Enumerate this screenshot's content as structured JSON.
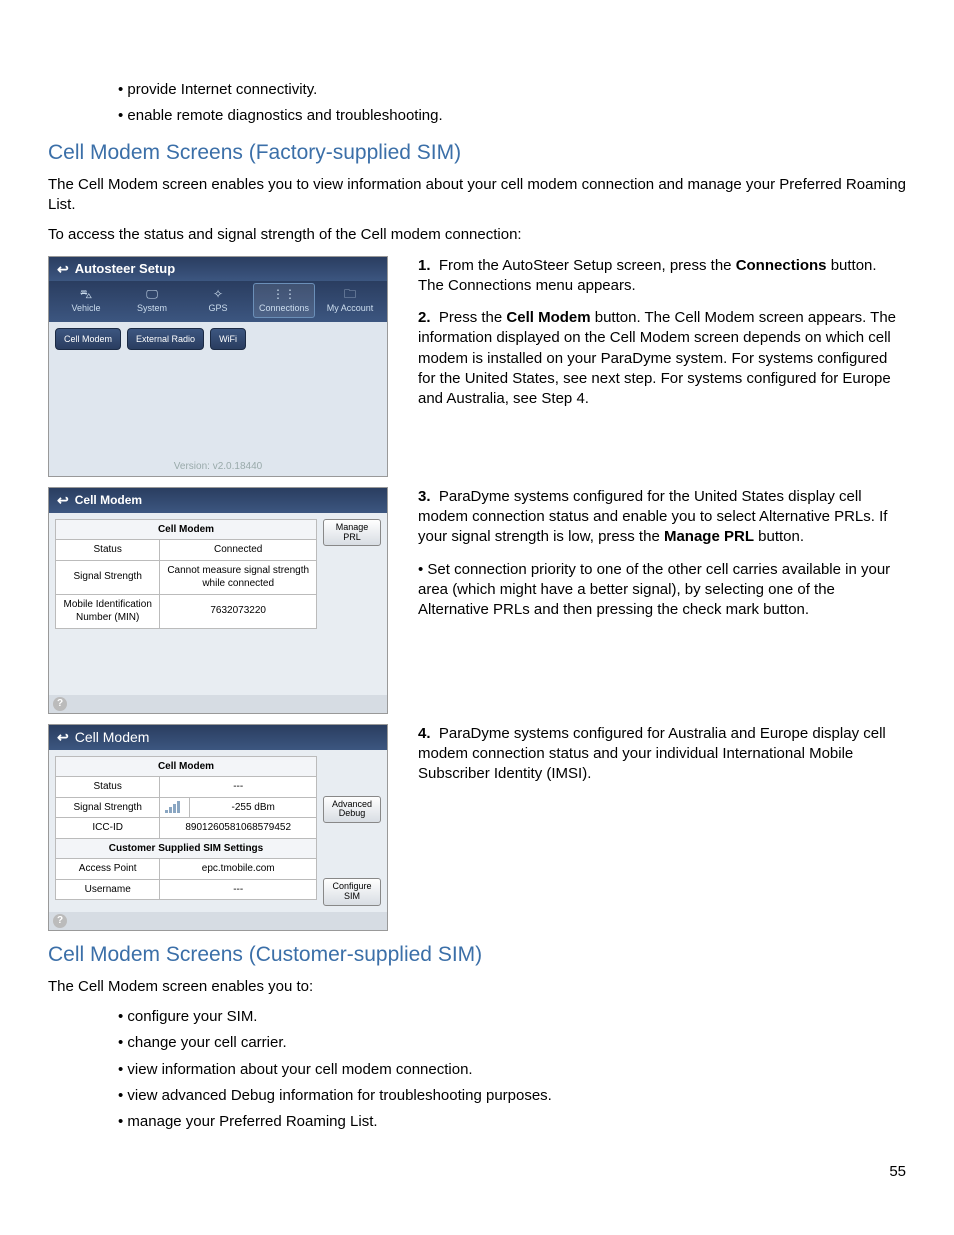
{
  "intro_bullets": [
    "provide Internet connectivity.",
    "enable remote diagnostics and troubleshooting."
  ],
  "section1": {
    "heading": "Cell Modem Screens (Factory-supplied SIM)",
    "para1": "The Cell Modem screen enables you to view information about your cell modem connection and manage your Preferred Roaming List.",
    "para2": "To access the status and signal strength of the Cell modem connection:"
  },
  "steps": {
    "s1_pre": "From the AutoSteer Setup screen, press the ",
    "s1_bold": "Connections",
    "s1_post": " button. The Connections menu appears.",
    "s2_pre": "Press the ",
    "s2_bold": "Cell Modem",
    "s2_post": " button. The Cell Modem screen appears. The information displayed on the Cell Modem screen depends on which cell modem is installed on your ParaDyme system. For systems configured for the United States, see next step. For systems configured for Europe and Australia, see Step 4.",
    "s3_pre": "ParaDyme systems configured for the United States display cell modem connection status and enable you to select Alternative PRLs. If your signal strength is low, press the ",
    "s3_bold": "Manage PRL",
    "s3_post": " button.",
    "s3_sub": "• Set connection priority to one of the other cell carries available in your area (which might have a better signal), by selecting one of the Alternative PRLs and then pressing the check mark button.",
    "s4": "ParaDyme systems configured for Australia and Europe display cell modem connection status and your individual International Mobile Subscriber Identity (IMSI)."
  },
  "shot1": {
    "title": "Autosteer Setup",
    "nav": [
      "Vehicle",
      "System",
      "GPS",
      "Connections",
      "My Account"
    ],
    "pills": [
      "Cell Modem",
      "External Radio",
      "WiFi"
    ],
    "version": "Version: v2.0.18440"
  },
  "shot2": {
    "title": "Cell Modem",
    "table_header": "Cell Modem",
    "rows": [
      {
        "label": "Status",
        "value": "Connected"
      },
      {
        "label": "Signal Strength",
        "value": "Cannot measure signal strength while connected"
      },
      {
        "label": "Mobile Identification Number (MIN)",
        "value": "7632073220"
      }
    ],
    "side_button": "Manage\nPRL"
  },
  "shot3": {
    "title": "Cell Modem",
    "table1_header": "Cell Modem",
    "rows1": [
      {
        "label": "Status",
        "value": "---"
      },
      {
        "label": "Signal Strength",
        "value": "-255 dBm"
      },
      {
        "label": "ICC-ID",
        "value": "8901260581068579452"
      }
    ],
    "table2_header": "Customer Supplied SIM Settings",
    "rows2": [
      {
        "label": "Access Point",
        "value": "epc.tmobile.com"
      },
      {
        "label": "Username",
        "value": "---"
      }
    ],
    "side_btn1": "Advanced\nDebug",
    "side_btn2": "Configure\nSIM"
  },
  "section2": {
    "heading": "Cell Modem Screens (Customer-supplied SIM)",
    "para": "The Cell Modem screen enables you to:",
    "bullets": [
      "configure your SIM.",
      "change your cell carrier.",
      "view information about your cell modem connection.",
      "view advanced Debug information for troubleshooting purposes.",
      "manage your Preferred Roaming List."
    ]
  },
  "page_number": "55"
}
